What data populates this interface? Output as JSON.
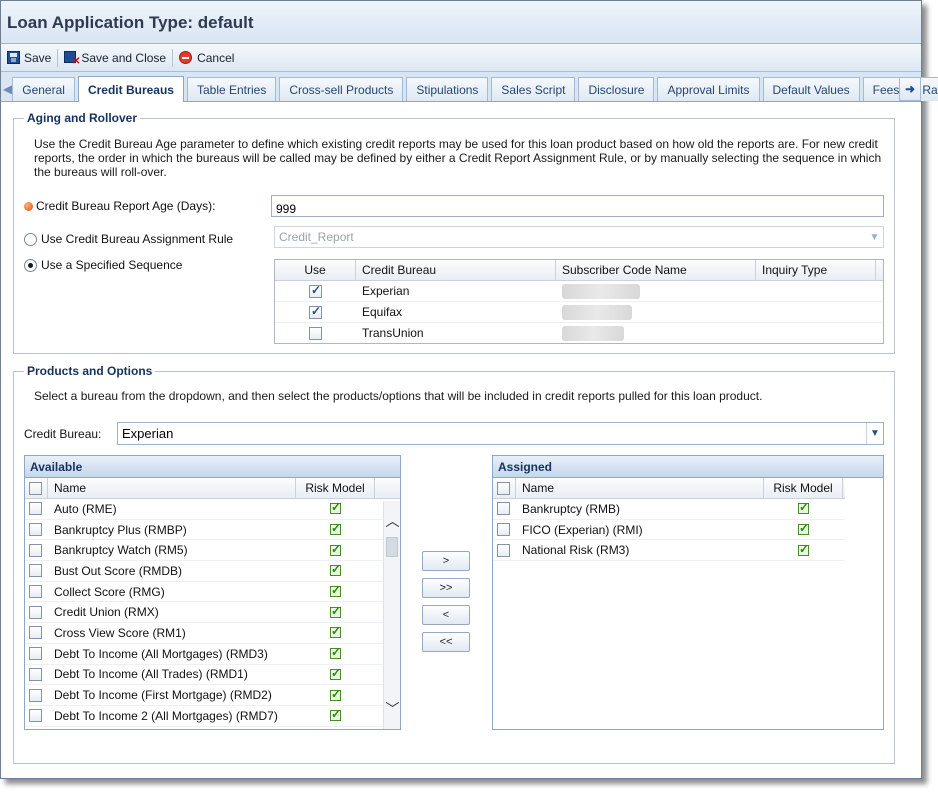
{
  "window": {
    "title": "Loan Application Type: default"
  },
  "toolbar": {
    "save": "Save",
    "save_close": "Save and Close",
    "cancel": "Cancel"
  },
  "tabs": [
    {
      "label": "General",
      "active": false
    },
    {
      "label": "Credit Bureaus",
      "active": true
    },
    {
      "label": "Table Entries",
      "active": false
    },
    {
      "label": "Cross-sell Products",
      "active": false
    },
    {
      "label": "Stipulations",
      "active": false
    },
    {
      "label": "Sales Script",
      "active": false
    },
    {
      "label": "Disclosure",
      "active": false
    },
    {
      "label": "Approval Limits",
      "active": false
    },
    {
      "label": "Default Values",
      "active": false
    },
    {
      "label": "Fees",
      "active": false
    },
    {
      "label": "Rates",
      "active": false
    }
  ],
  "aging": {
    "legend": "Aging and Rollover",
    "description": "Use the Credit Bureau Age parameter to define which existing credit reports may be used for this loan product based on how old the reports are. For new credit reports, the order in which the bureaus will be called may be defined by either a Credit Report Assignment Rule, or by manually selecting the sequence in which the bureaus will roll-over.",
    "report_age_label": "Credit Bureau Report Age (Days):",
    "report_age_value": "999",
    "assignment_rule_label": "Use Credit Bureau Assignment Rule",
    "assignment_rule_value": "Credit_Report",
    "sequence_label": "Use a Specified Sequence",
    "sequence_columns": [
      "Use",
      "Credit Bureau",
      "Subscriber Code Name",
      "Inquiry Type"
    ],
    "sequence_rows": [
      {
        "use": true,
        "bureau": "Experian"
      },
      {
        "use": true,
        "bureau": "Equifax"
      },
      {
        "use": false,
        "bureau": "TransUnion"
      }
    ]
  },
  "products": {
    "legend": "Products and Options",
    "description": "Select a bureau from the dropdown, and then select the products/options that will be included in credit reports pulled for this loan product.",
    "bureau_label": "Credit Bureau:",
    "bureau_value": "Experian",
    "available_title": "Available",
    "assigned_title": "Assigned",
    "col_name": "Name",
    "col_risk": "Risk Model",
    "available": [
      "Auto (RME)",
      "Bankruptcy Plus (RMBP)",
      "Bankruptcy Watch (RM5)",
      "Bust Out Score (RMDB)",
      "Collect Score (RMG)",
      "Credit Union (RMX)",
      "Cross View Score (RM1)",
      "Debt To Income (All Mortgages) (RMD3)",
      "Debt To Income (All Trades) (RMD1)",
      "Debt To Income (First Mortgage) (RMD2)",
      "Debt To Income 2 (All Mortgages) (RMD7)"
    ],
    "assigned": [
      "Bankruptcy (RMB)",
      "FICO (Experian) (RMI)",
      "National Risk (RM3)"
    ],
    "buttons": {
      "add": ">",
      "add_all": ">>",
      "remove": "<",
      "remove_all": "<<"
    }
  }
}
